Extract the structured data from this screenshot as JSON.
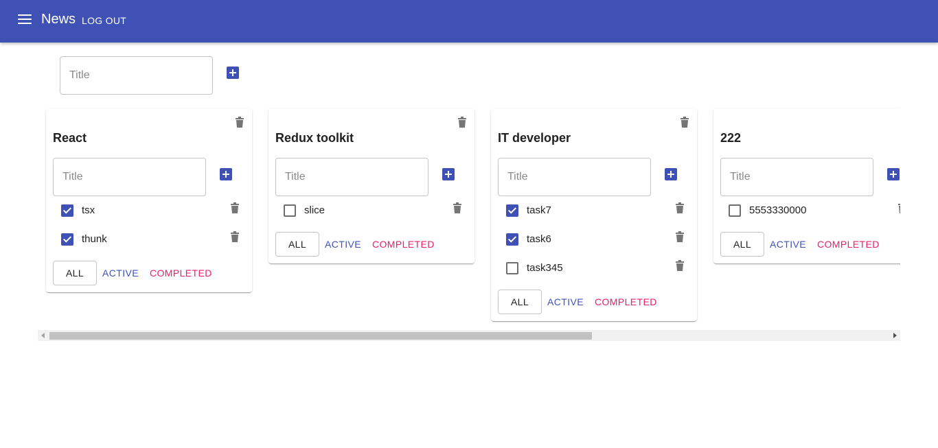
{
  "appbar": {
    "title": "News",
    "logout_label": "LOG OUT"
  },
  "new_list": {
    "placeholder": "Title"
  },
  "lists": [
    {
      "title": "React",
      "input_placeholder": "Title",
      "tasks": [
        {
          "label": "tsx",
          "checked": true
        },
        {
          "label": "thunk",
          "checked": true
        }
      ],
      "filters": {
        "all": "ALL",
        "active": "ACTIVE",
        "completed": "COMPLETED"
      }
    },
    {
      "title": "Redux toolkit",
      "input_placeholder": "Title",
      "tasks": [
        {
          "label": "slice",
          "checked": false
        }
      ],
      "filters": {
        "all": "ALL",
        "active": "ACTIVE",
        "completed": "COMPLETED"
      }
    },
    {
      "title": "IT developer",
      "input_placeholder": "Title",
      "tasks": [
        {
          "label": "task7",
          "checked": true
        },
        {
          "label": "task6",
          "checked": true
        },
        {
          "label": "task345",
          "checked": false
        }
      ],
      "filters": {
        "all": "ALL",
        "active": "ACTIVE",
        "completed": "COMPLETED"
      }
    },
    {
      "title": "222",
      "input_placeholder": "Title",
      "tasks": [
        {
          "label": "5553330000",
          "checked": false
        }
      ],
      "filters": {
        "all": "ALL",
        "active": "ACTIVE",
        "completed": "COMPLETED"
      }
    }
  ],
  "colors": {
    "primary": "#3f51b5",
    "secondary": "#e91e63",
    "icon_gray": "#757575"
  },
  "icons": {
    "menu": "menu-icon",
    "add": "add-box-icon",
    "delete": "delete-icon"
  }
}
